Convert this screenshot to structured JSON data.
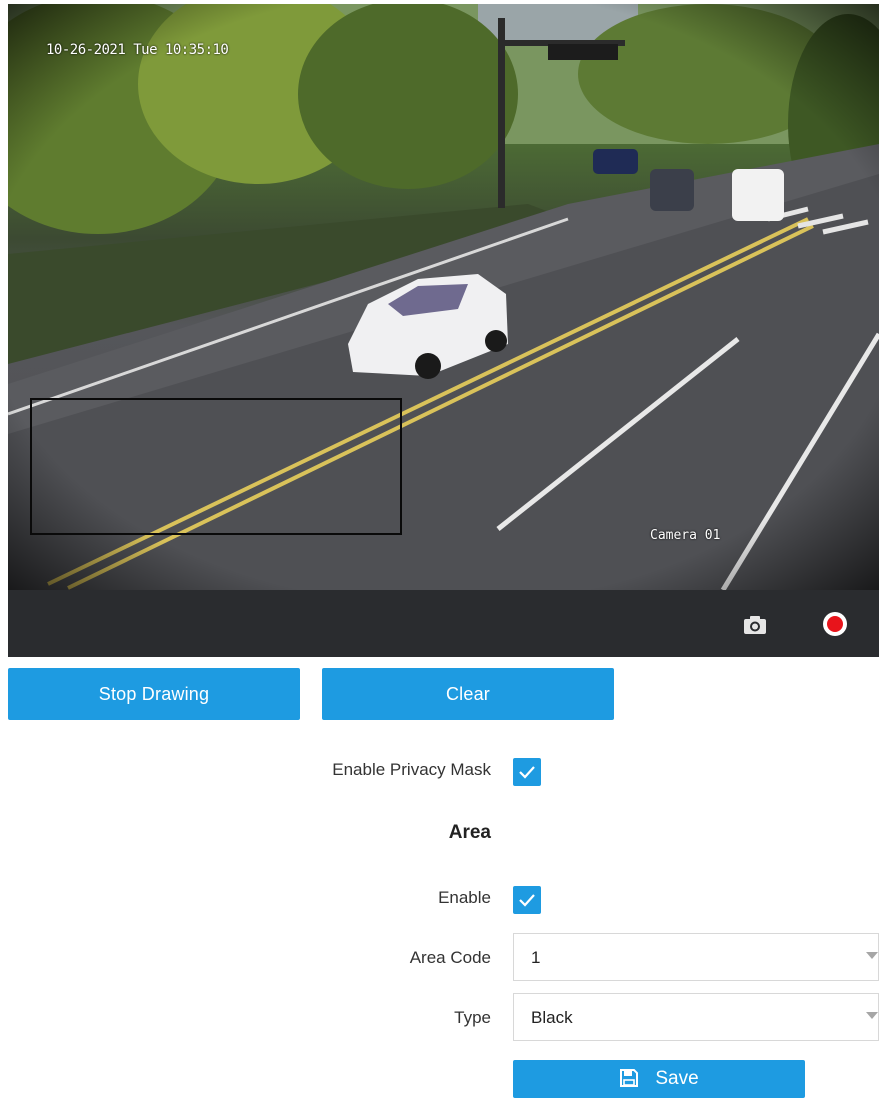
{
  "video": {
    "osd_datetime": "10-26-2021 Tue 10:35:10",
    "osd_camera_name": "Camera 01",
    "toolbar": {
      "snapshot_icon": "camera-icon",
      "record_icon": "record-icon",
      "record_color": "#e8141b"
    }
  },
  "drawing": {
    "stop_label": "Stop Drawing",
    "clear_label": "Clear"
  },
  "form": {
    "enable_privacy_mask_label": "Enable Privacy Mask",
    "enable_privacy_mask_checked": true,
    "area_heading": "Area",
    "enable_label": "Enable",
    "enable_checked": true,
    "area_code_label": "Area Code",
    "area_code_value": "1",
    "type_label": "Type",
    "type_value": "Black",
    "save_label": "Save",
    "save_icon": "floppy-disk-icon"
  },
  "colors": {
    "accent": "#1e9be1",
    "toolbar_bg": "#2a2c2f"
  }
}
